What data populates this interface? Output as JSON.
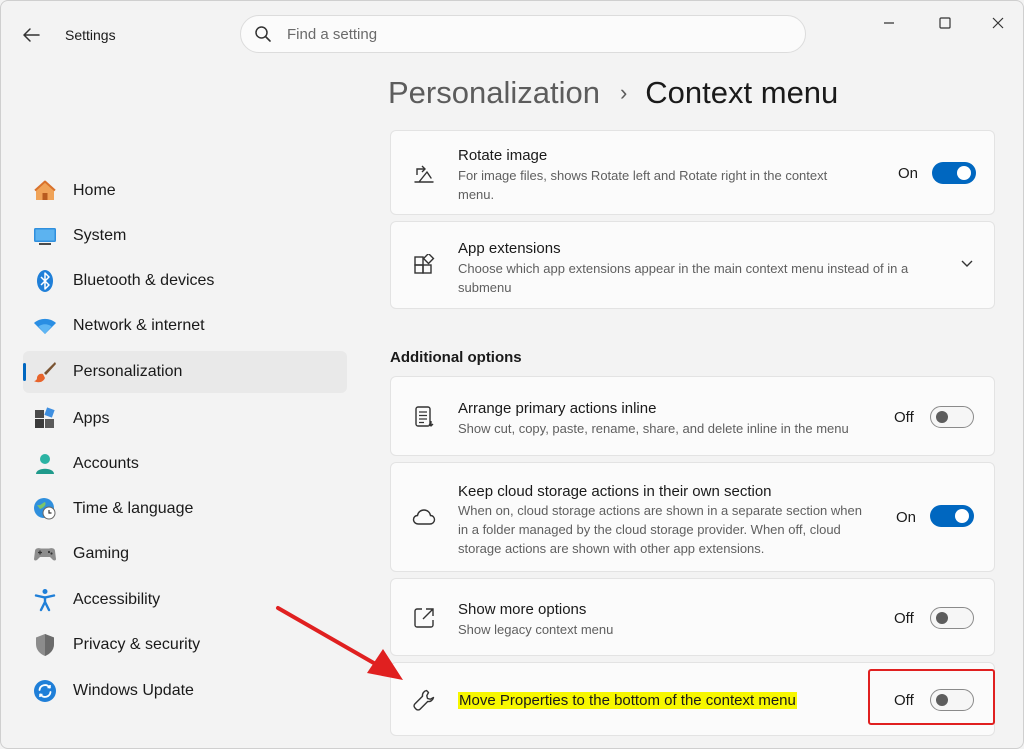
{
  "window": {
    "app_title": "Settings",
    "back_icon": "back-arrow-icon",
    "controls": [
      "minimize-icon",
      "maximize-icon",
      "close-icon"
    ]
  },
  "search": {
    "placeholder": "Find a setting",
    "icon": "search-icon"
  },
  "sidebar": {
    "items": [
      {
        "label": "Home",
        "icon": "home-icon"
      },
      {
        "label": "System",
        "icon": "system-icon"
      },
      {
        "label": "Bluetooth & devices",
        "icon": "bluetooth-icon"
      },
      {
        "label": "Network & internet",
        "icon": "wifi-icon"
      },
      {
        "label": "Personalization",
        "icon": "brush-icon",
        "active": true
      },
      {
        "label": "Apps",
        "icon": "apps-icon"
      },
      {
        "label": "Accounts",
        "icon": "account-icon"
      },
      {
        "label": "Time & language",
        "icon": "globe-clock-icon"
      },
      {
        "label": "Gaming",
        "icon": "gamepad-icon"
      },
      {
        "label": "Accessibility",
        "icon": "accessibility-icon"
      },
      {
        "label": "Privacy & security",
        "icon": "shield-icon"
      },
      {
        "label": "Windows Update",
        "icon": "update-icon"
      }
    ]
  },
  "header": {
    "parent": "Personalization",
    "separator": "›",
    "current": "Context menu"
  },
  "cards": {
    "rotate": {
      "title": "Rotate image",
      "desc": "For image files, shows Rotate left and Rotate right in the context menu.",
      "state": "On",
      "icon": "rotate-image-icon"
    },
    "extensions": {
      "title": "App extensions",
      "desc": "Choose which app extensions appear in the main context menu instead of in a submenu",
      "icon": "app-extensions-icon"
    }
  },
  "additional": {
    "title": "Additional options",
    "arrange": {
      "title": "Arrange primary actions inline",
      "desc": "Show cut, copy, paste, rename, share, and delete inline in the menu",
      "state": "Off",
      "icon": "list-icon"
    },
    "cloud": {
      "title": "Keep cloud storage actions in their own section",
      "desc": "When on, cloud storage actions are shown in a separate section when in a folder managed by the cloud storage provider. When off, cloud storage actions are shown with other app extensions.",
      "state": "On",
      "icon": "cloud-icon"
    },
    "more": {
      "title": "Show more options",
      "desc": "Show legacy context menu",
      "state": "Off",
      "icon": "open-external-icon"
    },
    "properties": {
      "title": "Move Properties to the bottom of the context menu",
      "state": "Off",
      "icon": "wrench-icon"
    }
  },
  "colors": {
    "accent": "#0067c0",
    "highlight": "#f7f700",
    "annotation": "#e02020"
  }
}
